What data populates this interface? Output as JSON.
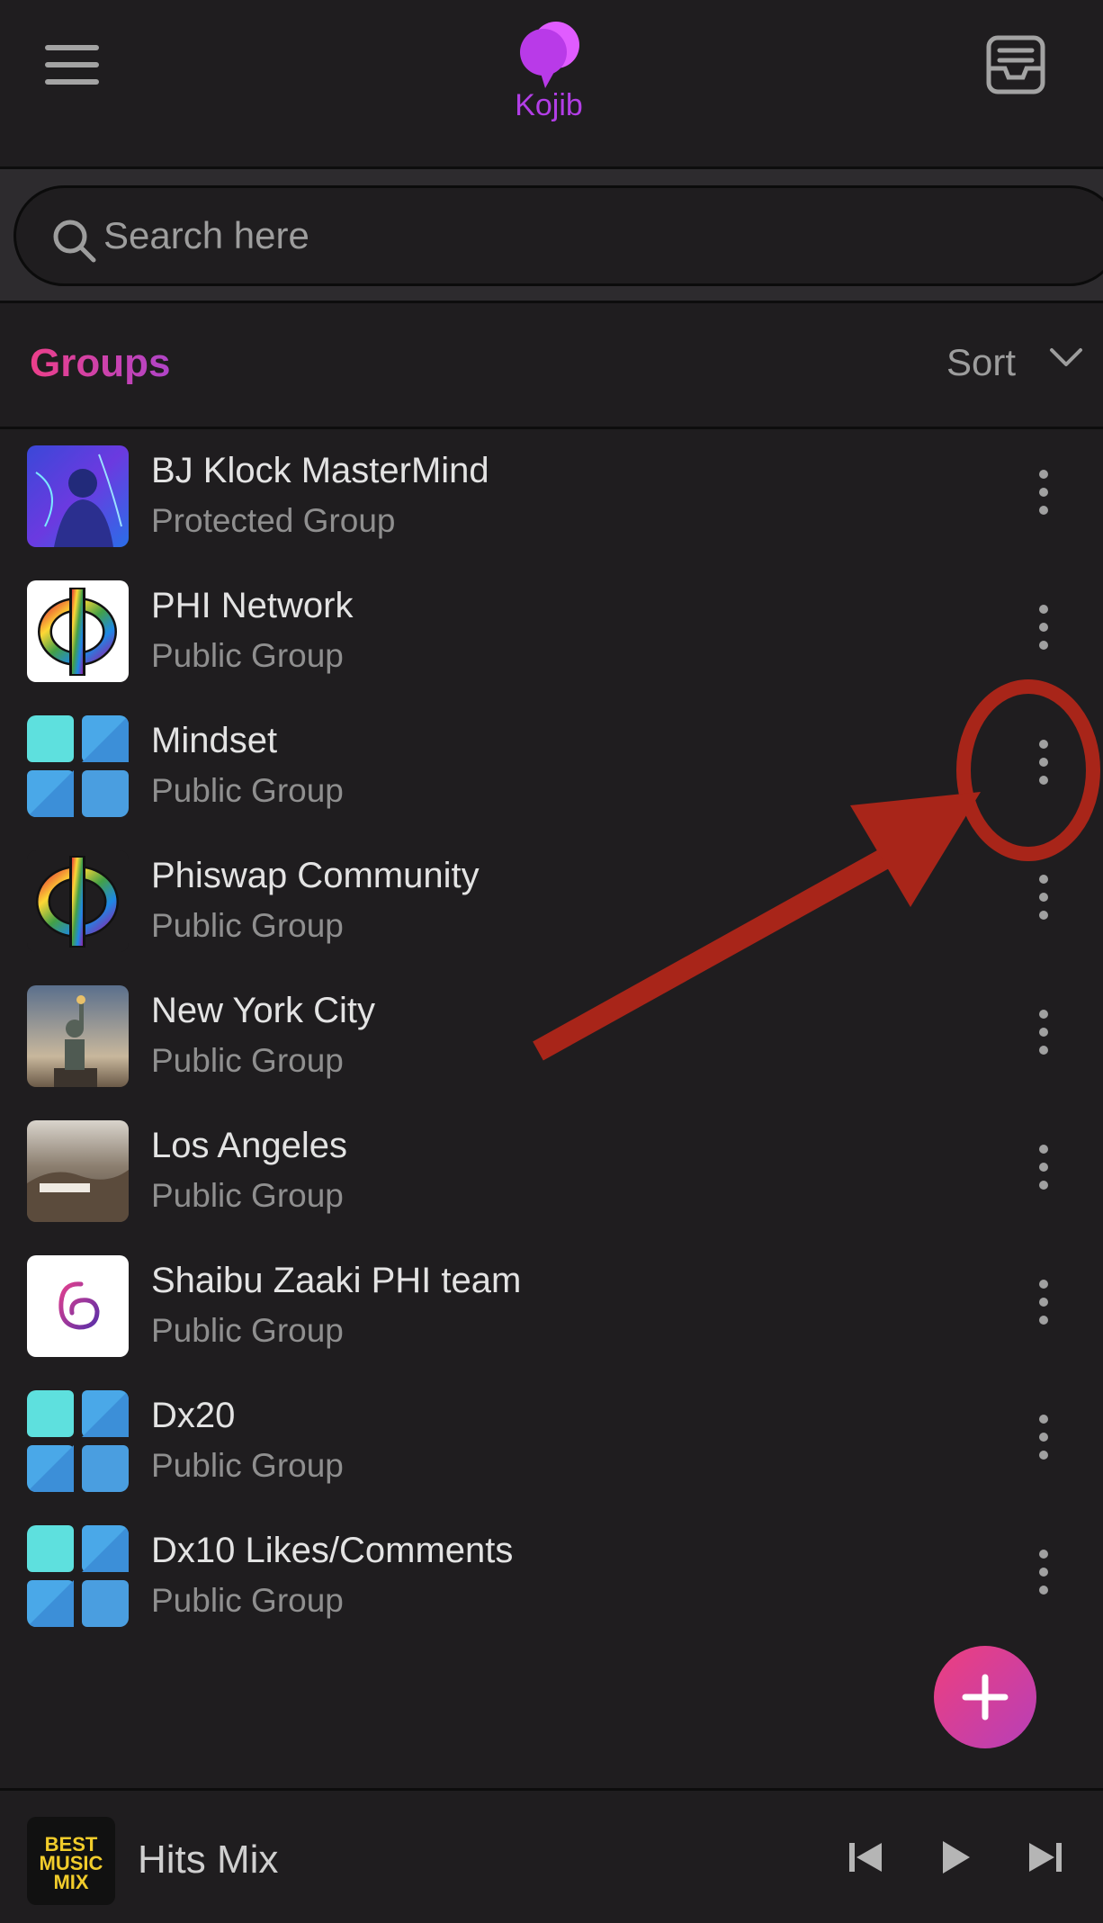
{
  "app": {
    "logo_text": "Kojib"
  },
  "search": {
    "placeholder": "Search here"
  },
  "groups": {
    "title": "Groups",
    "sort_label": "Sort",
    "items": [
      {
        "name": "BJ Klock MasterMind",
        "type": "Protected Group",
        "thumb": "photo-blue"
      },
      {
        "name": "PHI Network",
        "type": "Public Group",
        "thumb": "phi"
      },
      {
        "name": "Mindset",
        "type": "Public Group",
        "thumb": "tiles"
      },
      {
        "name": "Phiswap Community",
        "type": "Public Group",
        "thumb": "phi-dark"
      },
      {
        "name": "New York City",
        "type": "Public Group",
        "thumb": "liberty"
      },
      {
        "name": "Los Angeles",
        "type": "Public Group",
        "thumb": "hollywood"
      },
      {
        "name": "Shaibu Zaaki PHI team",
        "type": "Public Group",
        "thumb": "spiral"
      },
      {
        "name": "Dx20",
        "type": "Public Group",
        "thumb": "tiles"
      },
      {
        "name": "Dx10 Likes/Comments",
        "type": "Public Group",
        "thumb": "tiles"
      }
    ]
  },
  "player": {
    "track": "Hits Mix",
    "album_art_lines": [
      "BEST",
      "MUSIC",
      "MIX"
    ]
  },
  "colors": {
    "accent": "#e9417f",
    "brand": "#b23ee6",
    "annotation": "#a82519"
  }
}
